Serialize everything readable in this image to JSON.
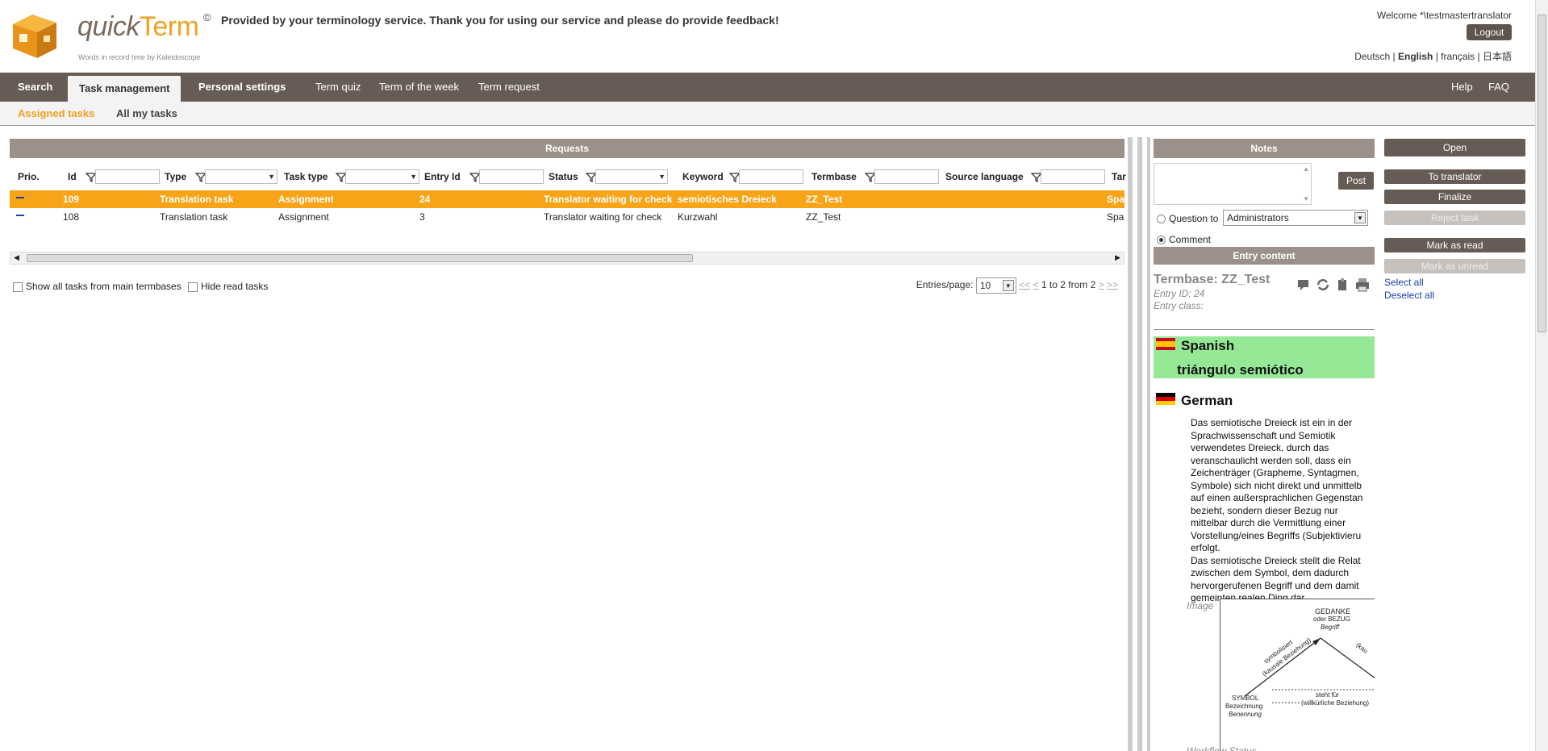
{
  "header": {
    "logo_word1": "quick",
    "logo_word2": "Term",
    "tagline": "Words in record time by Kaleidoscope",
    "copyright": "©",
    "message": "Provided by your terminology service. Thank you for using our service and please do provide feedback!",
    "welcome": "Welcome *\\testmastertranslator",
    "logout": "Logout",
    "languages": [
      "Deutsch",
      "English",
      "français",
      "日本語"
    ],
    "active_language": "English"
  },
  "nav": {
    "items": [
      "Search",
      "Task management",
      "Personal settings",
      "Term quiz",
      "Term of the week",
      "Term request"
    ],
    "right_items": [
      "Help",
      "FAQ"
    ],
    "active": "Task management"
  },
  "subnav": {
    "items": [
      "Assigned tasks",
      "All my tasks"
    ],
    "active": "Assigned tasks"
  },
  "requests": {
    "title": "Requests",
    "columns": [
      "Prio.",
      "Id",
      "Type",
      "Task type",
      "Entry Id",
      "Status",
      "Keyword",
      "Termbase",
      "Source language",
      "Tar"
    ],
    "rows": [
      {
        "id": "109",
        "type": "Translation task",
        "task_type": "Assignment",
        "entry_id": "24",
        "status": "Translator waiting for check",
        "keyword": "semiotisches Dreieck",
        "termbase": "ZZ_Test",
        "target": "Span",
        "selected": true
      },
      {
        "id": "108",
        "type": "Translation task",
        "task_type": "Assignment",
        "entry_id": "3",
        "status": "Translator waiting for check",
        "keyword": "Kurzwahl",
        "termbase": "ZZ_Test",
        "target": "Span",
        "selected": false
      }
    ],
    "show_all_label": "Show all tasks from main termbases",
    "hide_read_label": "Hide read tasks",
    "entries_per_page_label": "Entries/page:",
    "entries_per_page": "10",
    "pager_first": "<<",
    "pager_prev": "<",
    "pager_info": "1 to 2 from 2",
    "pager_next": ">",
    "pager_last": ">>"
  },
  "notes": {
    "title": "Notes",
    "post": "Post",
    "question_to": "Question to",
    "recipient": "Administrators",
    "comment": "Comment"
  },
  "entry": {
    "title": "Entry content",
    "termbase": "Termbase: ZZ_Test",
    "entry_id": "Entry ID: 24",
    "entry_class": "Entry class:",
    "spanish_label": "Spanish",
    "spanish_term": "triángulo semiótico",
    "german_label": "German",
    "german_desc": [
      "Das semiotische Dreieck ist ein in der",
      "Sprachwissenschaft und Semiotik",
      "verwendetes Dreieck, durch das",
      "veranschaulicht werden soll, dass ein",
      "Zeichenträger (Grapheme, Syntagmen,",
      "Symbole) sich nicht direkt und unmittelb",
      "auf einen außersprachlichen Gegenstan",
      "bezieht, sondern dieser Bezug nur",
      "mittelbar durch die Vermittlung einer",
      "Vorstellung/eines Begriffs (Subjektivieru",
      "erfolgt.",
      "Das semiotische Dreieck stellt die Relat",
      "zwischen dem Symbol, dem dadurch",
      "hervorgerufenen Begriff und dem damit",
      "gemeinten realen Ding dar."
    ],
    "image_label": "Image",
    "diagram": {
      "gedanke": "GEDANKE",
      "oder_bezug": "oder BEZUG",
      "begriff": "Begriff",
      "symbolisiert": "symbolisiert",
      "kausale": "(kausale Beziehung)",
      "symbol": "SYMBOL",
      "bezeichnung": "Bezeichnung",
      "benennung": "Benennung",
      "steht_fuer": "steht für",
      "willkuerlich": "(willkürliche Beziehung)",
      "kau": "(kau"
    },
    "workflow_partial": "Workflow Status"
  },
  "actions": {
    "open": "Open",
    "to_translator": "To translator",
    "finalize": "Finalize",
    "reject": "Reject task",
    "mark_read": "Mark as read",
    "mark_unread": "Mark as unread",
    "select_all": "Select all",
    "deselect_all": "Deselect all"
  },
  "colors": {
    "nav_bg": "#675c55",
    "accent": "#f7a418",
    "panel_header": "#9b908a",
    "spanish_bg": "#95e895"
  }
}
